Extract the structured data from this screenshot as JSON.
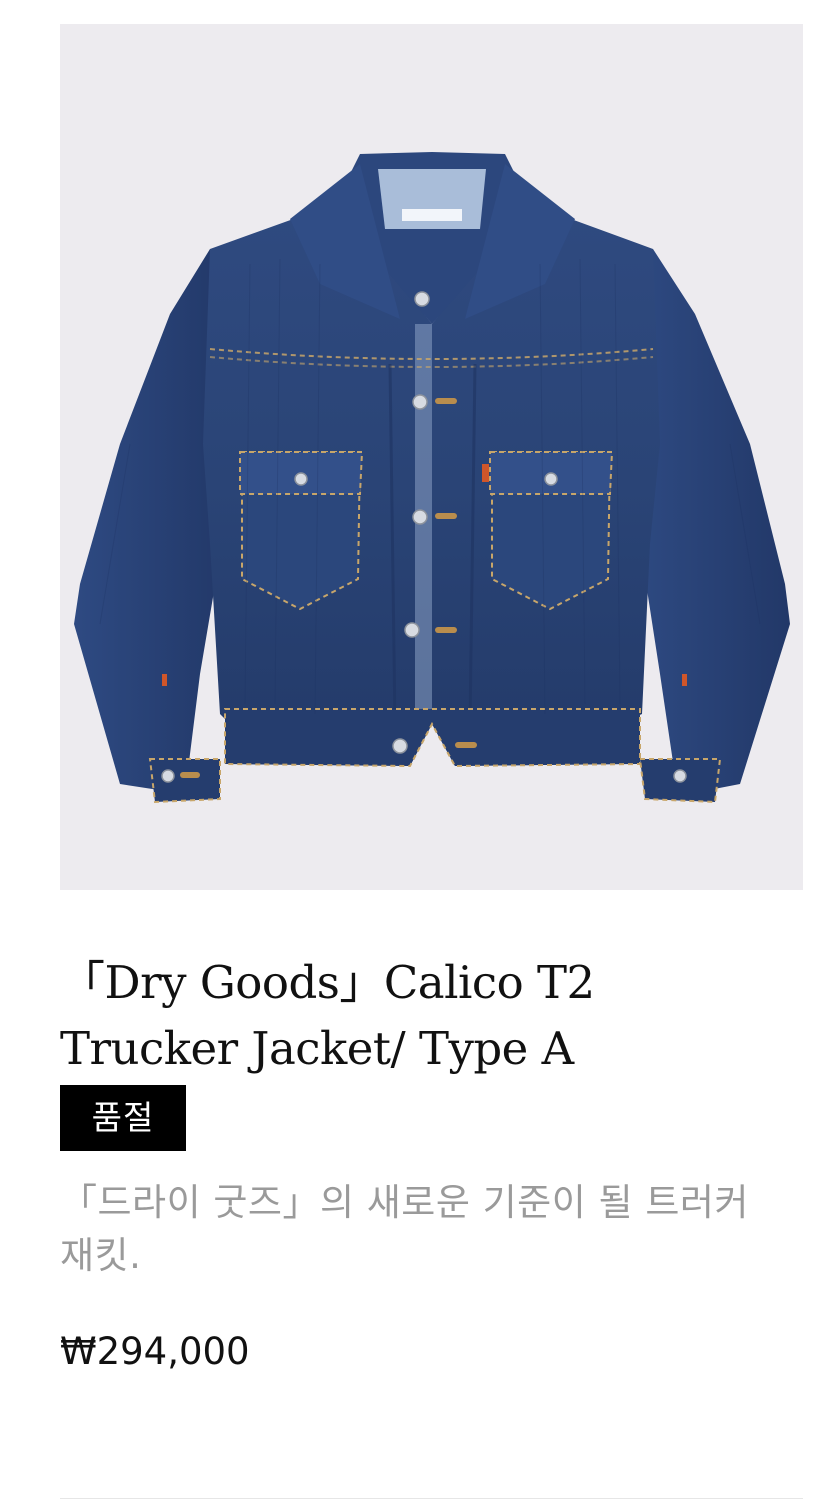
{
  "product": {
    "image_alt": "denim-trucker-jacket",
    "title": "「Dry Goods」Calico T2 Trucker Jacket/ Type A",
    "badge": "품절",
    "description": "「드라이 굿즈」의 새로운 기준이 될 트러커 재킷.",
    "price": "₩294,000"
  },
  "colors": {
    "image_background": "#edebef",
    "denim": "#2b4579",
    "badge_background": "#000000",
    "description_text": "#9a9a9a"
  }
}
